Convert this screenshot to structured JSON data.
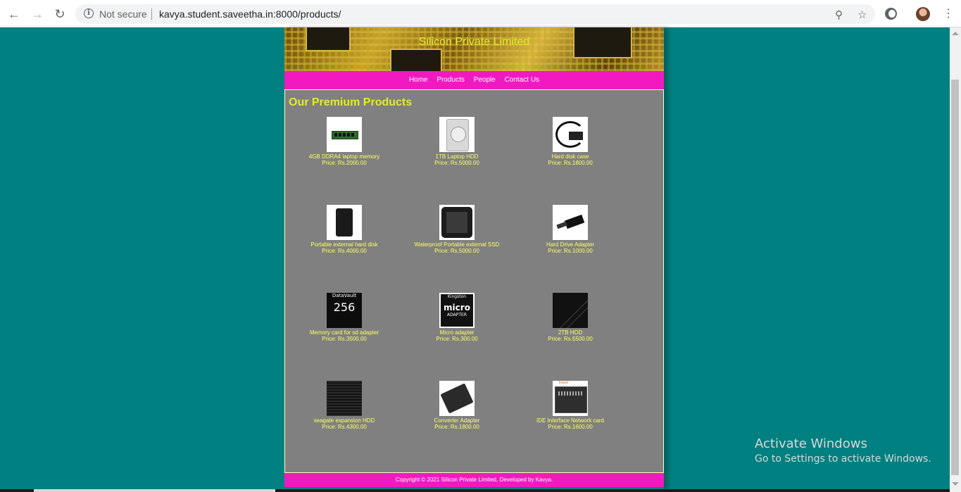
{
  "browser": {
    "security_label": "Not secure",
    "url": "kavya.student.saveetha.in:8000/products/"
  },
  "site": {
    "title": "Silicon Private Limited",
    "nav": [
      "Home",
      "Products",
      "People",
      "Contact Us"
    ],
    "section_heading": "Our Premium Products",
    "footer": "Copyright © 2021 Silicon Private Limited, Developed by Kavya."
  },
  "products": [
    {
      "name": "4GB DDRA4 laptop memory",
      "price": "Price: Rs.2000.00",
      "icon": "ram-stick"
    },
    {
      "name": "1TB Laptop HDD",
      "price": "Price: Rs.5000.00",
      "icon": "laptop-hdd"
    },
    {
      "name": "Hard disk case",
      "price": "Price: Rs.1800.00",
      "icon": "disk-case"
    },
    {
      "name": "Portable external hard disk",
      "price": "Price: Rs.4000.00",
      "icon": "external-disk"
    },
    {
      "name": "Waterproof Portable external SSD",
      "price": "Price: Rs.5000.00",
      "icon": "external-ssd"
    },
    {
      "name": "Hard Drive Adapter",
      "price": "Price: Rs.1000.00",
      "icon": "drive-adapter"
    },
    {
      "name": "Memory card for sd adapter",
      "price": "Price: Rs.3500.00",
      "icon": "sd-card"
    },
    {
      "name": "Micro adapter",
      "price": "Price: Rs.300.00",
      "icon": "micro-sd-adapter"
    },
    {
      "name": "2TB HDD",
      "price": "Price: Rs.5500.00",
      "icon": "2tb-hdd"
    },
    {
      "name": "seagate expansion HDD",
      "price": "Price: Rs.4300.00",
      "icon": "seagate-hdd"
    },
    {
      "name": "Converter Adapter",
      "price": "Price: Rs.1800.00",
      "icon": "converter-adapter"
    },
    {
      "name": "IDE Interface Network card",
      "price": "Price: Rs.1600.00",
      "icon": "ide-card"
    }
  ],
  "product_images": {
    "sd_card_brand": "DataVault",
    "sd_card_capacity": "256",
    "micro_brand": "Kingston",
    "micro_text": "micro",
    "micro_sub": "ADAPTER",
    "ide_label": "brand"
  },
  "watermark": {
    "line1": "Activate Windows",
    "line2": "Go to Settings to activate Windows."
  },
  "colors": {
    "background": "#008080",
    "nav_bar": "#f01ac0",
    "content_bg": "#808080",
    "accent_text": "#e2ec2a"
  }
}
